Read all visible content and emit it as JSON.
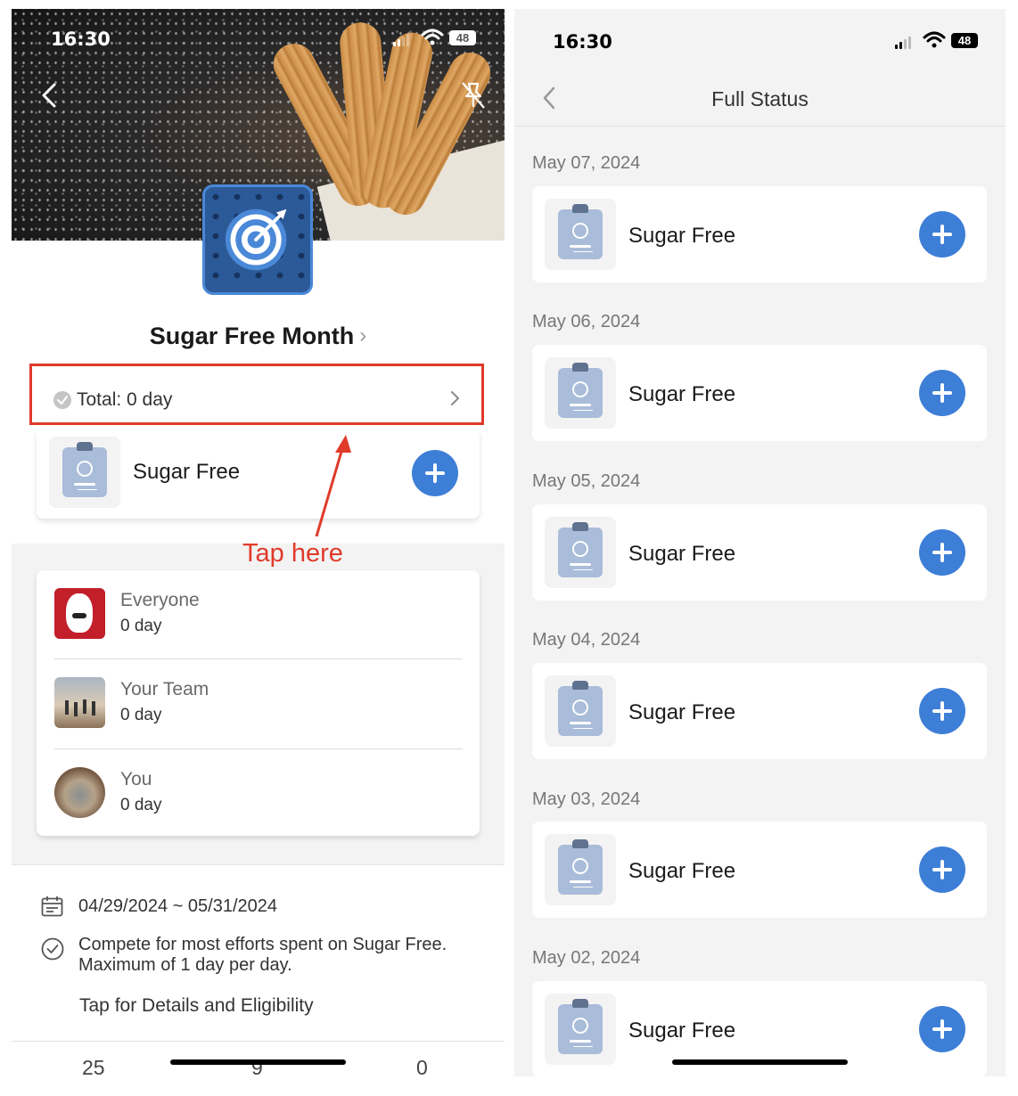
{
  "left": {
    "status_bar": {
      "time": "16:30",
      "battery": "48"
    },
    "challenge": {
      "title": "Sugar Free Month",
      "total": "Total: 0 day",
      "activity": {
        "label": "Sugar Free"
      }
    },
    "annotation": {
      "text": "Tap here",
      "color": "#e03a2a"
    },
    "rankings": [
      {
        "name": "Everyone",
        "value": "0 day"
      },
      {
        "name": "Your Team",
        "value": "0 day"
      },
      {
        "name": "You",
        "value": "0 day"
      }
    ],
    "info": {
      "date_range": "04/29/2024 ~ 05/31/2024",
      "description_line1": "Compete for most efforts spent on Sugar Free.",
      "description_line2": "Maximum of 1 day per day.",
      "details_link": "Tap for Details and Eligibility"
    },
    "stats": [
      "25",
      "9",
      "0"
    ]
  },
  "right": {
    "status_bar": {
      "time": "16:30",
      "battery": "48"
    },
    "title": "Full Status",
    "days": [
      {
        "date": "May 07, 2024",
        "activity": "Sugar Free"
      },
      {
        "date": "May 06, 2024",
        "activity": "Sugar Free"
      },
      {
        "date": "May 05, 2024",
        "activity": "Sugar Free"
      },
      {
        "date": "May 04, 2024",
        "activity": "Sugar Free"
      },
      {
        "date": "May 03, 2024",
        "activity": "Sugar Free"
      },
      {
        "date": "May 02, 2024",
        "activity": "Sugar Free"
      }
    ]
  },
  "colors": {
    "accent_blue": "#3d7ed6",
    "highlight_red": "#e03a2a",
    "background_gray": "#f3f3f3"
  }
}
